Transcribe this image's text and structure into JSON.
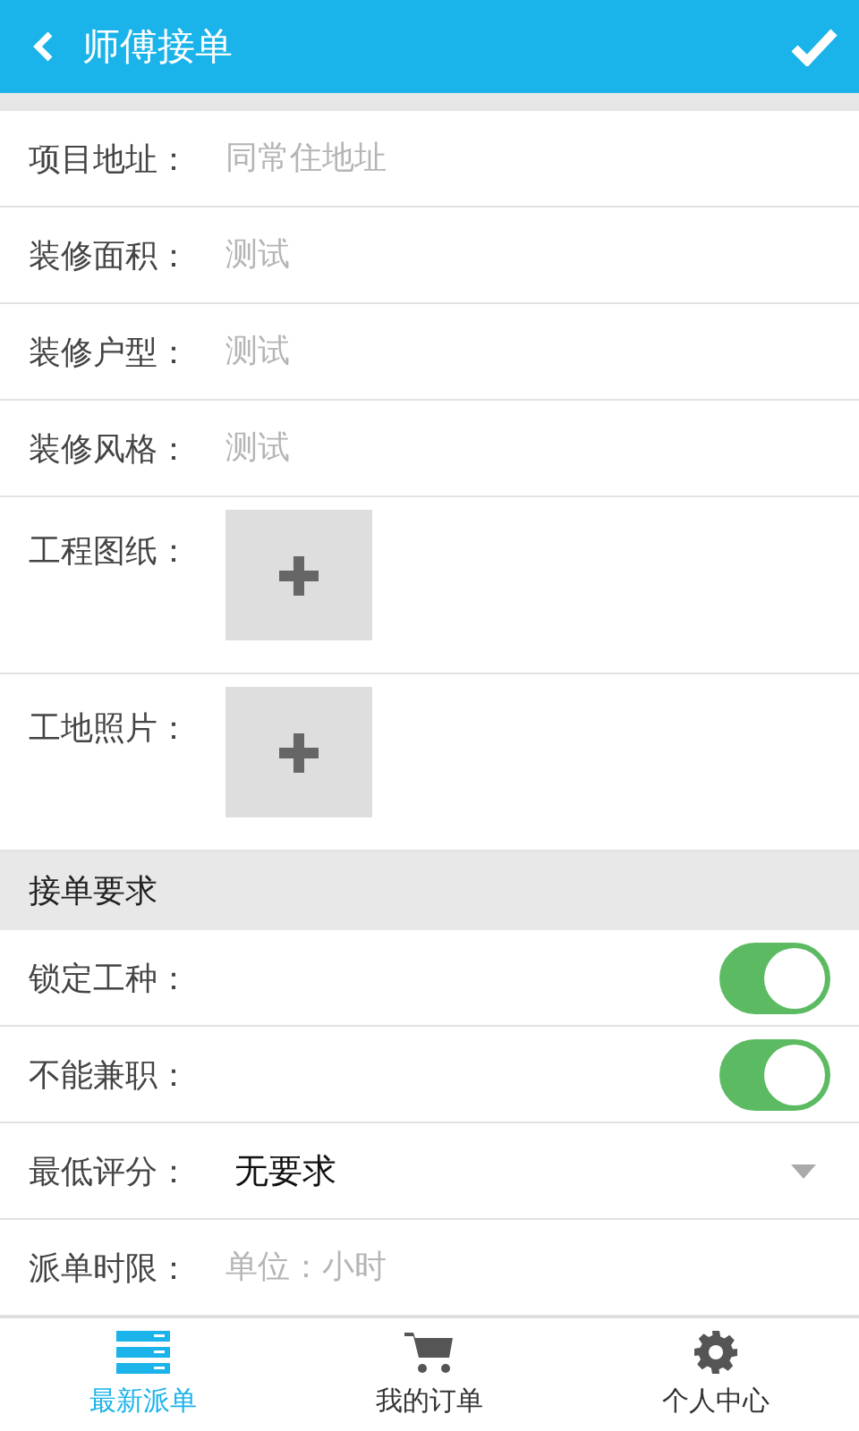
{
  "header": {
    "title": "师傅接单"
  },
  "fields": [
    {
      "kind": "text",
      "label": "项目地址：",
      "placeholder": "同常住地址"
    },
    {
      "kind": "text",
      "label": "装修面积：",
      "placeholder": "测试"
    },
    {
      "kind": "text",
      "label": "装修户型：",
      "placeholder": "测试"
    },
    {
      "kind": "text",
      "label": "装修风格：",
      "placeholder": "测试"
    },
    {
      "kind": "upload",
      "label": "工程图纸："
    },
    {
      "kind": "upload",
      "label": "工地照片："
    }
  ],
  "section": {
    "title": "接单要求"
  },
  "requirements": [
    {
      "kind": "toggle",
      "label": "锁定工种：",
      "on": true
    },
    {
      "kind": "toggle",
      "label": "不能兼职：",
      "on": true
    },
    {
      "kind": "select",
      "label": "最低评分：",
      "value": "无要求"
    },
    {
      "kind": "text",
      "label": "派单时限：",
      "placeholder": "单位：小时"
    }
  ],
  "tabs": [
    {
      "label": "最新派单",
      "selected": true
    },
    {
      "label": "我的订单",
      "selected": false
    },
    {
      "label": "个人中心",
      "selected": false
    }
  ]
}
